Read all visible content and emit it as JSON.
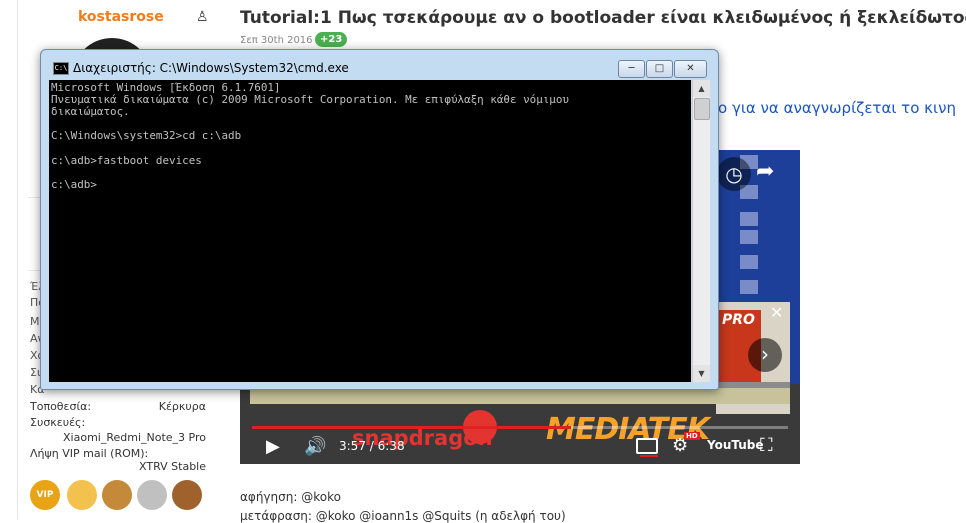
{
  "profile": {
    "username": "kostasrose",
    "truncated_labels": [
      "Έλ",
      "Πο",
      "Μη",
      "Αν",
      "Χα",
      "Συ",
      "Κα"
    ],
    "rows": [
      {
        "label": "Τοποθεσία:",
        "value": "Κέρκυρα"
      },
      {
        "label": "Συσκευές:",
        "value": ""
      },
      {
        "label": "",
        "value": "Xiaomi_Redmi_Note_3 Pro"
      },
      {
        "label": "Λήψη VIP mail (ROM):",
        "value": "XTRV Stable"
      }
    ],
    "badge_icons": [
      "vip-badge-icon",
      "user-badge-icon",
      "palette-badge-icon",
      "medal-badge-icon",
      "bronze-medal-badge-icon"
    ]
  },
  "article": {
    "title": "Tutorial:1 Πως τσεκάρουμε αν ο bootloader είναι κλειδωμένος ή ξεκλείδωτος",
    "date": "Σεπ 30th 2016",
    "votes": "+23",
    "link_text_fragment": "ο για να αναγνωρίζεται το κινη",
    "credit_narration": "αφήγηση: @koko",
    "credit_translation": "μετάφραση: @koko @ioann1s @Squits (η αδελφή του)"
  },
  "video": {
    "time_current": "3:57",
    "time_total": "6:38",
    "progress": 0.596,
    "brand_left": "snapdragon",
    "brand_right": "MEDIATEK",
    "youtube_label": "YouTube",
    "hd_label": "HD",
    "end_card_label": "PRO"
  },
  "cmd": {
    "title": "Διαχειριστής: C:\\Windows\\System32\\cmd.exe",
    "icon_label": "C:\\",
    "lines": [
      "Microsoft Windows [Έκδοση 6.1.7601]",
      "Πνευματικά δικαιώματα (c) 2009 Microsoft Corporation. Με επιφύλαξη κάθε νόμιμου",
      "δικαιώματος.",
      "",
      "C:\\Windows\\system32>cd c:\\adb",
      "",
      "c:\\adb>fastboot devices",
      "",
      "c:\\adb>"
    ]
  },
  "colors": {
    "username": "#f07d1a",
    "votes_bg": "#4caf50",
    "link": "#1a56c2",
    "progress": "#e02020",
    "console_bg": "#000000",
    "console_fg": "#c0c0c0"
  }
}
